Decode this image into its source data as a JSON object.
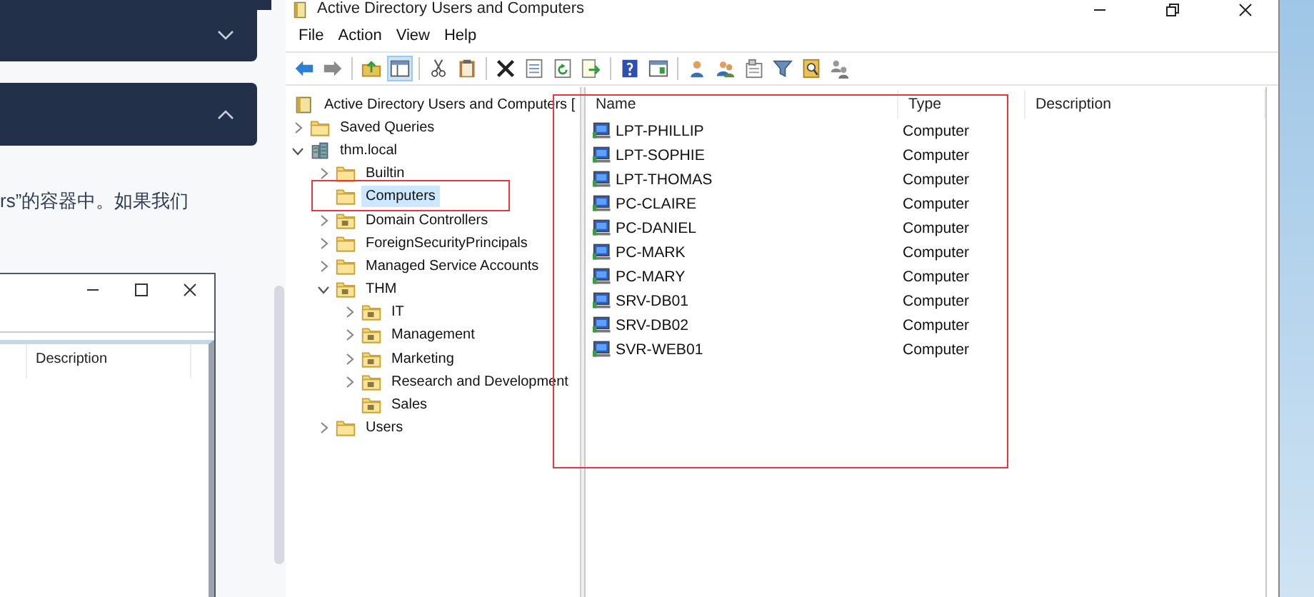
{
  "webpage": {
    "accordion": [
      {
        "expanded": false
      },
      {
        "expanded": true
      }
    ],
    "paragraph_fragment": "rs”的容器中。如果我们",
    "background_window": {
      "column_header": "Description"
    }
  },
  "window": {
    "title": "Active Directory Users and Computers",
    "menu": [
      "File",
      "Action",
      "View",
      "Help"
    ],
    "toolbar": [
      [
        {
          "kind": "back",
          "pressed": false
        },
        {
          "kind": "forward",
          "pressed": false
        }
      ],
      [
        {
          "kind": "up",
          "pressed": false
        },
        {
          "kind": "console",
          "pressed": true
        }
      ],
      [
        {
          "kind": "cut",
          "pressed": false
        },
        {
          "kind": "paste",
          "pressed": false
        }
      ],
      [
        {
          "kind": "delete",
          "pressed": false
        },
        {
          "kind": "properties",
          "pressed": false
        },
        {
          "kind": "refresh",
          "pressed": false
        },
        {
          "kind": "export",
          "pressed": false
        }
      ],
      [
        {
          "kind": "help",
          "pressed": false
        },
        {
          "kind": "panel",
          "pressed": false
        }
      ],
      [
        {
          "kind": "user",
          "pressed": false
        },
        {
          "kind": "users",
          "pressed": false
        },
        {
          "kind": "container",
          "pressed": false
        },
        {
          "kind": "filter",
          "pressed": false
        },
        {
          "kind": "find",
          "pressed": false
        },
        {
          "kind": "delegate",
          "pressed": false
        }
      ]
    ],
    "tree": [
      {
        "label": "Active Directory Users and Computers [",
        "kind": "root",
        "selected": false,
        "children": [
          {
            "label": "Saved Queries",
            "kind": "folder",
            "expanded": false,
            "selected": false
          },
          {
            "label": "thm.local",
            "kind": "domain",
            "expanded": true,
            "selected": false,
            "children": [
              {
                "label": "Builtin",
                "kind": "folder",
                "expanded": false,
                "selected": false
              },
              {
                "label": "Computers",
                "kind": "folder",
                "selected": true
              },
              {
                "label": "Domain Controllers",
                "kind": "ou",
                "expanded": false,
                "selected": false
              },
              {
                "label": "ForeignSecurityPrincipals",
                "kind": "folder",
                "expanded": false,
                "selected": false
              },
              {
                "label": "Managed Service Accounts",
                "kind": "folder",
                "expanded": false,
                "selected": false
              },
              {
                "label": "THM",
                "kind": "ou",
                "expanded": true,
                "selected": false,
                "children": [
                  {
                    "label": "IT",
                    "kind": "ou",
                    "expanded": false,
                    "selected": false
                  },
                  {
                    "label": "Management",
                    "kind": "ou",
                    "expanded": false,
                    "selected": false
                  },
                  {
                    "label": "Marketing",
                    "kind": "ou",
                    "expanded": false,
                    "selected": false
                  },
                  {
                    "label": "Research and Development",
                    "kind": "ou",
                    "expanded": false,
                    "selected": false
                  },
                  {
                    "label": "Sales",
                    "kind": "ou",
                    "selected": false
                  }
                ]
              },
              {
                "label": "Users",
                "kind": "folder",
                "expanded": false,
                "selected": false
              }
            ]
          }
        ]
      }
    ],
    "list": {
      "columns": [
        "Name",
        "Type",
        "Description"
      ],
      "rows": [
        {
          "name": "LPT-PHILLIP",
          "type": "Computer"
        },
        {
          "name": "LPT-SOPHIE",
          "type": "Computer"
        },
        {
          "name": "LPT-THOMAS",
          "type": "Computer"
        },
        {
          "name": "PC-CLAIRE",
          "type": "Computer"
        },
        {
          "name": "PC-DANIEL",
          "type": "Computer"
        },
        {
          "name": "PC-MARK",
          "type": "Computer"
        },
        {
          "name": "PC-MARY",
          "type": "Computer"
        },
        {
          "name": "SRV-DB01",
          "type": "Computer"
        },
        {
          "name": "SRV-DB02",
          "type": "Computer"
        },
        {
          "name": "SVR-WEB01",
          "type": "Computer"
        }
      ]
    }
  },
  "annotations": [
    {
      "kind": "box"
    },
    {
      "kind": "box"
    }
  ]
}
